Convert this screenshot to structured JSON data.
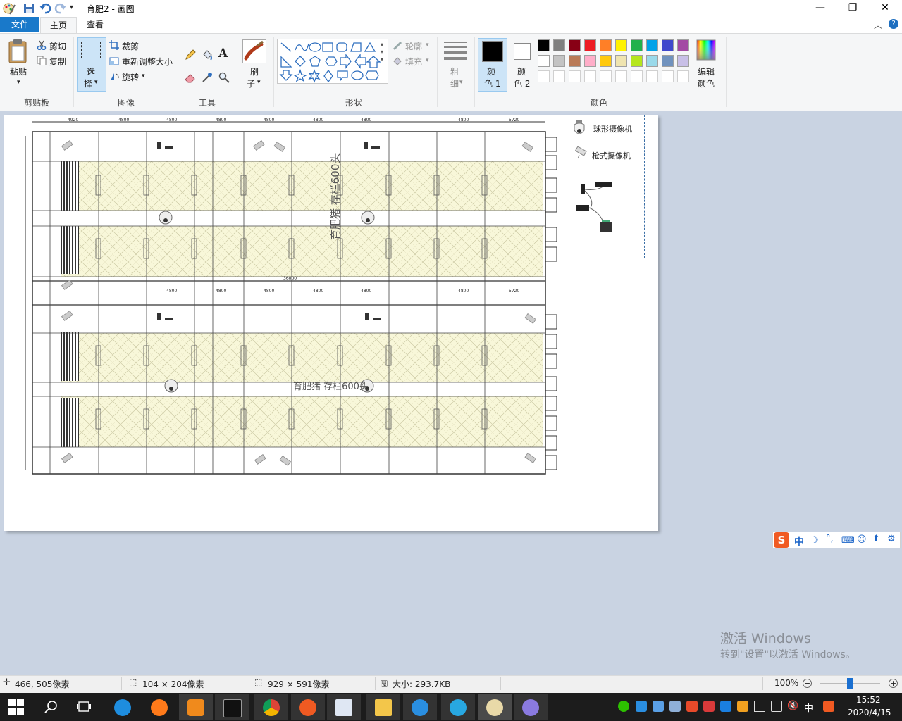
{
  "window": {
    "title": "育肥2 - 画图",
    "buttons": {
      "minimize": "—",
      "maximize": "❐",
      "close": "✕"
    }
  },
  "tabs": {
    "file": "文件",
    "home": "主页",
    "view": "查看"
  },
  "ribbon": {
    "clipboard": {
      "paste": "粘贴",
      "cut": "剪切",
      "copy": "复制",
      "group": "剪贴板"
    },
    "image": {
      "select_line1": "选",
      "select_line2": "择",
      "crop": "裁剪",
      "resize": "重新调整大小",
      "rotate": "旋转",
      "group": "图像"
    },
    "tools": {
      "group": "工具",
      "text_tool": "A"
    },
    "brush": {
      "line1": "刷",
      "line2": "子"
    },
    "shapes": {
      "outline": "轮廓",
      "fill": "填充",
      "group": "形状"
    },
    "size": {
      "line1": "粗",
      "line2": "细"
    },
    "color1": {
      "line1": "颜",
      "line2": "色 1"
    },
    "color2": {
      "line1": "颜",
      "line2": "色 2"
    },
    "edit_colors": {
      "line1": "编辑",
      "line2": "颜色"
    },
    "colors_group": "颜色",
    "palette_row1": [
      "#000000",
      "#7f7f7f",
      "#880015",
      "#ed1c24",
      "#ff7f27",
      "#fff200",
      "#22b14c",
      "#00a2e8",
      "#3f48cc",
      "#a349a4"
    ],
    "palette_row2": [
      "#ffffff",
      "#c3c3c3",
      "#b97a57",
      "#ffaec9",
      "#ffc90e",
      "#efe4b0",
      "#b5e61d",
      "#99d9ea",
      "#7092be",
      "#c8bfe7"
    ],
    "color1_value": "#000000",
    "color2_value": "#ffffff"
  },
  "drawing": {
    "legend_dome": "球形摄像机",
    "legend_bullet": "枪式摄像机",
    "label_upper": "育肥猪 存栏600头",
    "label_lower": "育肥猪 存栏600头",
    "dims_top": [
      "4920",
      "4800",
      "4800",
      "4800",
      "4800",
      "4800",
      "4800",
      "4800",
      "5720"
    ],
    "dims_mid": [
      "4800",
      "4800",
      "4800",
      "4800",
      "4800",
      "4800",
      "5720"
    ],
    "total_dim": "36000"
  },
  "status": {
    "cursor": "466, 505像素",
    "selection": "104 × 204像素",
    "image_size": "929 × 591像素",
    "file_size": "大小: 293.7KB",
    "zoom": "100%"
  },
  "ime": {
    "lang": "中"
  },
  "activation": {
    "title": "激活 Windows",
    "subtitle": "转到\"设置\"以激活 Windows。"
  },
  "taskbar": {
    "tray_lang": "中",
    "time": "15:52",
    "date": "2020/4/15"
  }
}
